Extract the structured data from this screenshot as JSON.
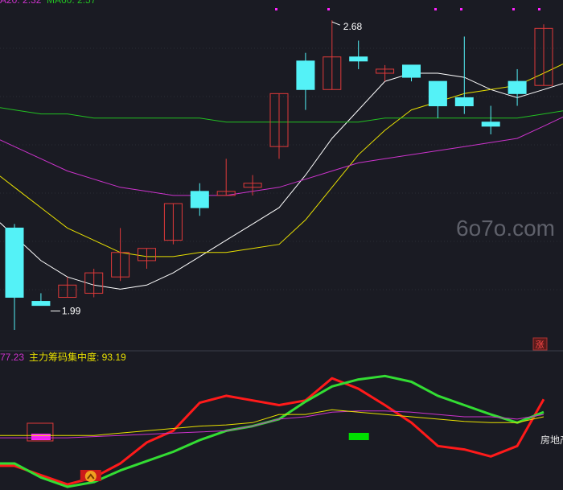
{
  "colors": {
    "background": "#1a1b23",
    "up": "#e03a3a",
    "down": "#54f2f7",
    "ma5": "#ffffff",
    "ma10": "#e8e000",
    "ma20": "#cc33cc",
    "ma60": "#22c022",
    "grid": "#2a2d36",
    "red_line": "#ff1a1a",
    "green_line": "#33dd33",
    "magenta_box": "#ff22ff",
    "green_box": "#00e000"
  },
  "header": {
    "ma_label": "A20: 2.32",
    "ma60_label": "MA60: 2.57"
  },
  "price_annotations": {
    "high_label": "2.68",
    "low_label": "1.99"
  },
  "watermark": "6o7o.com",
  "zhang_badge": "涨",
  "indicator": {
    "value_left": "77.23",
    "name": "主力筹码集中度: 93.19"
  },
  "side_label": "房地产",
  "chart_data": [
    {
      "type": "candlestick",
      "title": "",
      "ylim": [
        1.92,
        2.71
      ],
      "candles": [
        {
          "o": 2.17,
          "h": 2.18,
          "l": 1.92,
          "c": 2.0
        },
        {
          "o": 1.99,
          "h": 2.01,
          "l": 1.99,
          "c": 1.98
        },
        {
          "o": 2.0,
          "h": 2.05,
          "l": 2.0,
          "c": 2.03
        },
        {
          "o": 2.01,
          "h": 2.07,
          "l": 2.0,
          "c": 2.06
        },
        {
          "o": 2.05,
          "h": 2.17,
          "l": 2.04,
          "c": 2.11
        },
        {
          "o": 2.09,
          "h": 2.12,
          "l": 2.07,
          "c": 2.12
        },
        {
          "o": 2.14,
          "h": 2.23,
          "l": 2.13,
          "c": 2.23
        },
        {
          "o": 2.26,
          "h": 2.28,
          "l": 2.2,
          "c": 2.22
        },
        {
          "o": 2.25,
          "h": 2.34,
          "l": 2.25,
          "c": 2.26
        },
        {
          "o": 2.27,
          "h": 2.3,
          "l": 2.25,
          "c": 2.28
        },
        {
          "o": 2.37,
          "h": 2.5,
          "l": 2.34,
          "c": 2.5
        },
        {
          "o": 2.58,
          "h": 2.6,
          "l": 2.46,
          "c": 2.51
        },
        {
          "o": 2.51,
          "h": 2.68,
          "l": 2.51,
          "c": 2.59
        },
        {
          "o": 2.59,
          "h": 2.63,
          "l": 2.56,
          "c": 2.58
        },
        {
          "o": 2.55,
          "h": 2.57,
          "l": 2.53,
          "c": 2.56
        },
        {
          "o": 2.57,
          "h": 2.57,
          "l": 2.53,
          "c": 2.54
        },
        {
          "o": 2.53,
          "h": 2.53,
          "l": 2.44,
          "c": 2.47
        },
        {
          "o": 2.49,
          "h": 2.64,
          "l": 2.45,
          "c": 2.47
        },
        {
          "o": 2.43,
          "h": 2.47,
          "l": 2.4,
          "c": 2.42
        },
        {
          "o": 2.53,
          "h": 2.56,
          "l": 2.47,
          "c": 2.5
        },
        {
          "o": 2.52,
          "h": 2.67,
          "l": 2.52,
          "c": 2.66
        }
      ],
      "series": [
        {
          "key": "ma5",
          "values": [
            2.15,
            2.09,
            2.05,
            2.03,
            2.02,
            2.03,
            2.06,
            2.1,
            2.14,
            2.18,
            2.22,
            2.3,
            2.39,
            2.46,
            2.53,
            2.55,
            2.55,
            2.54,
            2.51,
            2.49,
            2.51
          ]
        },
        {
          "key": "ma10",
          "values": [
            2.27,
            2.22,
            2.17,
            2.14,
            2.11,
            2.1,
            2.1,
            2.11,
            2.11,
            2.12,
            2.13,
            2.19,
            2.27,
            2.35,
            2.41,
            2.46,
            2.48,
            2.5,
            2.51,
            2.52,
            2.55
          ]
        },
        {
          "key": "ma20",
          "values": [
            2.37,
            2.34,
            2.31,
            2.29,
            2.27,
            2.26,
            2.25,
            2.25,
            2.25,
            2.26,
            2.27,
            2.29,
            2.31,
            2.33,
            2.34,
            2.35,
            2.36,
            2.37,
            2.38,
            2.39,
            2.42
          ]
        },
        {
          "key": "ma60",
          "values": [
            2.46,
            2.45,
            2.45,
            2.44,
            2.44,
            2.44,
            2.44,
            2.44,
            2.43,
            2.43,
            2.43,
            2.43,
            2.43,
            2.43,
            2.44,
            2.44,
            2.44,
            2.44,
            2.44,
            2.44,
            2.45
          ]
        }
      ]
    },
    {
      "type": "line",
      "title": "主力筹码集中度",
      "ylim": [
        0,
        100
      ],
      "series": [
        {
          "key": "red",
          "values": [
            18,
            10,
            2,
            8,
            20,
            38,
            48,
            72,
            78,
            74,
            70,
            74,
            93,
            84,
            70,
            55,
            35,
            32,
            26,
            35,
            75
          ]
        },
        {
          "key": "green",
          "values": [
            20,
            8,
            0,
            4,
            14,
            22,
            30,
            40,
            48,
            52,
            58,
            73,
            86,
            92,
            95,
            90,
            78,
            70,
            62,
            55,
            64
          ]
        },
        {
          "key": "magenta",
          "values": [
            42,
            42,
            42,
            43,
            44,
            45,
            46,
            47,
            48,
            52,
            58,
            60,
            64,
            65,
            65,
            64,
            62,
            60,
            60,
            58,
            62
          ]
        },
        {
          "key": "yellow",
          "values": [
            44,
            44,
            44,
            44,
            46,
            48,
            50,
            52,
            53,
            55,
            62,
            62,
            66,
            64,
            62,
            60,
            58,
            56,
            55,
            55,
            60
          ]
        }
      ],
      "bars": [
        {
          "index": 1,
          "value": 42,
          "color_key": "magenta_box"
        },
        {
          "index": 13,
          "value": 42,
          "color_key": "green_box"
        }
      ]
    }
  ]
}
